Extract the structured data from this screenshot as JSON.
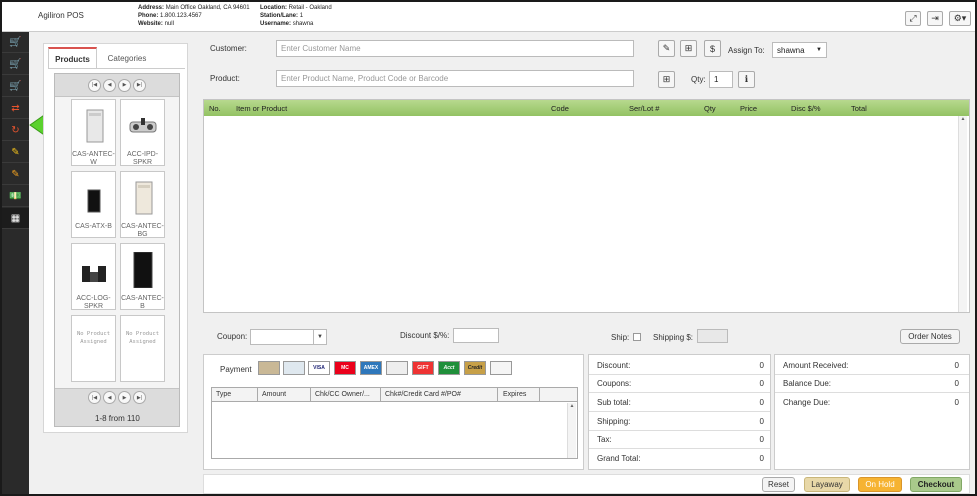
{
  "header": {
    "app_title": "Agiliron POS",
    "address_label": "Address:",
    "address": "Main Office Oakland, CA 94601",
    "phone_label": "Phone:",
    "phone": "1.800.123.4567",
    "website_label": "Website:",
    "website": "null",
    "location_label": "Location:",
    "location": "Retail - Oakland",
    "station_label": "Station/Lane:",
    "station": "1",
    "username_label": "Username:",
    "username": "shawna"
  },
  "sidebar": {
    "items": [
      "cart-icon",
      "cart-icon",
      "cart-return-icon",
      "exchange-icon",
      "refresh-icon",
      "edit-icon",
      "edit-icon",
      "money-icon",
      "grid-icon"
    ]
  },
  "product_panel": {
    "tabs": [
      "Products",
      "Categories"
    ],
    "products": [
      {
        "label": "CAS-ANTEC-W",
        "icon": "white-tower-icon"
      },
      {
        "label": "ACC-IPD-SPKR",
        "icon": "speaker-dock-icon"
      },
      {
        "label": "CAS-ATX-B",
        "icon": "black-small-case-icon"
      },
      {
        "label": "CAS-ANTEC-BG",
        "icon": "beige-tower-icon"
      },
      {
        "label": "ACC-LOG-SPKR",
        "icon": "speakers-icon"
      },
      {
        "label": "CAS-ANTEC-B",
        "icon": "black-tower-icon"
      },
      {
        "label": "No Product Assigned",
        "icon": ""
      },
      {
        "label": "No Product Assigned",
        "icon": ""
      }
    ],
    "count_text": "1-8 from 110"
  },
  "form": {
    "customer_label": "Customer:",
    "customer_placeholder": "Enter Customer Name",
    "product_label": "Product:",
    "product_placeholder": "Enter Product Name, Product Code or Barcode",
    "assign_label": "Assign To:",
    "assign_value": "shawna",
    "qty_label": "Qty:",
    "qty_value": "1"
  },
  "order_table": {
    "columns": [
      "No.",
      "Item or Product",
      "Code",
      "Ser/Lot #",
      "Qty",
      "Price",
      "Disc $/%",
      "Total"
    ]
  },
  "coupon_row": {
    "coupon_label": "Coupon:",
    "discount_label": "Discount $/%:",
    "ship_label": "Ship:",
    "shipping_label": "Shipping $:",
    "order_notes": "Order Notes"
  },
  "payment": {
    "label": "Payment",
    "icons": [
      "VISA",
      "MC",
      "AMEX",
      "GIFT",
      "Acct",
      "Credit"
    ],
    "columns": [
      "Type",
      "Amount",
      "Chk/CC Owner/...",
      "Chk#/Credit Card #/PO#",
      "Expires"
    ]
  },
  "totals": {
    "rows": [
      {
        "label": "Discount:",
        "value": "0"
      },
      {
        "label": "Coupons:",
        "value": "0"
      },
      {
        "label": "Sub total:",
        "value": "0"
      },
      {
        "label": "Shipping:",
        "value": "0"
      },
      {
        "label": "Tax:",
        "value": "0"
      },
      {
        "label": "Grand Total:",
        "value": "0"
      }
    ],
    "right_rows": [
      {
        "label": "Amount Received:",
        "value": "0"
      },
      {
        "label": "Balance Due:",
        "value": "0"
      },
      {
        "label": "Change Due:",
        "value": "0"
      }
    ]
  },
  "actions": {
    "reset": "Reset",
    "layaway": "Layaway",
    "on_hold": "On Hold",
    "checkout": "Checkout"
  }
}
